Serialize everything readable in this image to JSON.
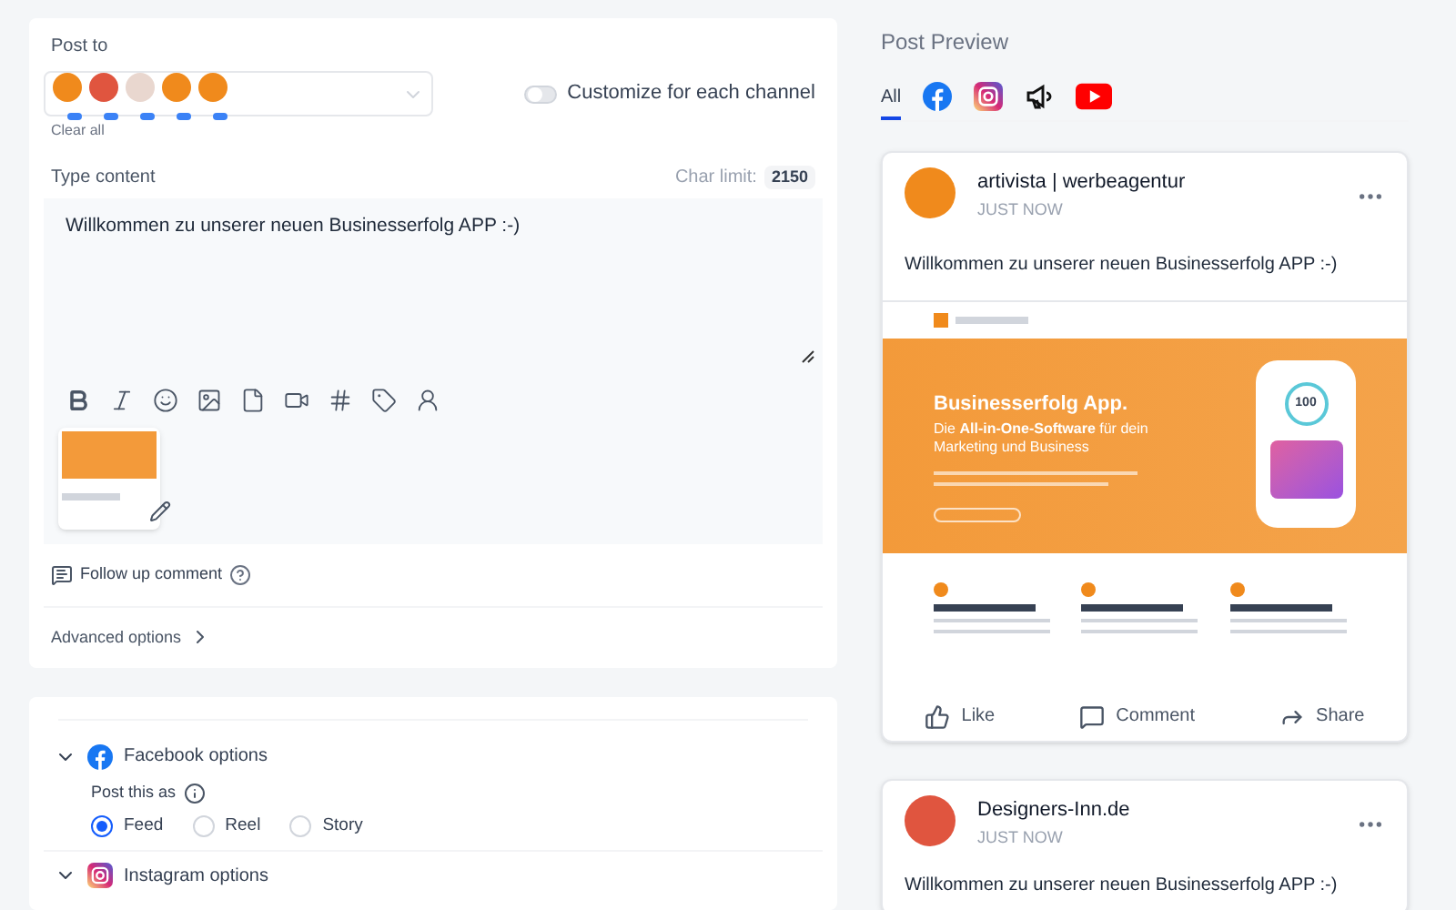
{
  "post_to": {
    "label": "Post to",
    "channels": [
      {
        "color": "#f08a1c"
      },
      {
        "color": "#e0553f"
      },
      {
        "color": "#e9d7cf"
      },
      {
        "color": "#f08a1c"
      },
      {
        "color": "#f08a1c"
      }
    ],
    "clear": "Clear all",
    "customize": {
      "label": "Customize for each channel",
      "on": false
    }
  },
  "content": {
    "label": "Type content",
    "char_limit_label": "Char limit:",
    "char_limit": "2150",
    "text": "Willkommen zu unserer neuen Businesserfolg APP :-)"
  },
  "follow_up": "Follow up comment",
  "advanced": "Advanced options",
  "facebook_options": {
    "title": "Facebook options",
    "expanded": true,
    "post_as_label": "Post this as",
    "options": [
      {
        "label": "Feed",
        "selected": true
      },
      {
        "label": "Reel",
        "selected": false
      },
      {
        "label": "Story",
        "selected": false
      }
    ]
  },
  "instagram_options": {
    "title": "Instagram options",
    "expanded": true
  },
  "preview": {
    "title": "Post Preview",
    "tabs": [
      {
        "kind": "text",
        "label": "All",
        "selected": true
      },
      {
        "kind": "facebook",
        "selected": false
      },
      {
        "kind": "instagram",
        "selected": false
      },
      {
        "kind": "megaphone",
        "selected": false
      },
      {
        "kind": "youtube",
        "selected": false
      }
    ],
    "posts": [
      {
        "name": "artivista | werbeagentur",
        "time": "JUST NOW",
        "text": "Willkommen zu unserer neuen Businesserfolg APP :-)",
        "color": "#f08a1c",
        "image": {
          "headline": "Businesserfolg App.",
          "subline": "Die **All-in-One-Software** für dein Marketing und Business",
          "score": "100"
        },
        "actions": [
          "Like",
          "Comment",
          "Share"
        ]
      },
      {
        "name": "Designers-Inn.de",
        "time": "JUST NOW",
        "text": "Willkommen zu unserer neuen Businesserfolg APP :-)",
        "color": "#e0553f"
      }
    ]
  }
}
